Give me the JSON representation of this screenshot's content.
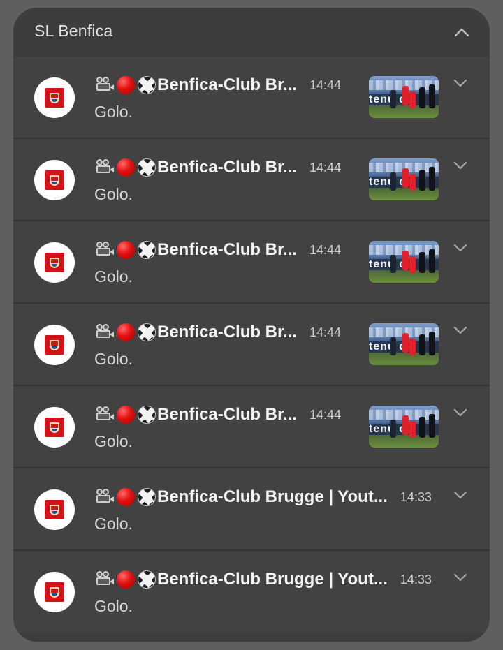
{
  "group": {
    "title": "SL Benfica",
    "collapse_icon": "chevron-up-icon"
  },
  "notifications": [
    {
      "title": "Benfica-Club Br...",
      "time": "14:44",
      "body": "Golo.",
      "has_thumbnail": true
    },
    {
      "title": "Benfica-Club Br...",
      "time": "14:44",
      "body": "Golo.",
      "has_thumbnail": true
    },
    {
      "title": "Benfica-Club Br...",
      "time": "14:44",
      "body": "Golo.",
      "has_thumbnail": true
    },
    {
      "title": "Benfica-Club Br...",
      "time": "14:44",
      "body": "Golo.",
      "has_thumbnail": true
    },
    {
      "title": "Benfica-Club Br...",
      "time": "14:44",
      "body": "Golo.",
      "has_thumbnail": true
    },
    {
      "title": "Benfica-Club Brugge | Yout...",
      "time": "14:33",
      "body": "Golo.",
      "has_thumbnail": false
    },
    {
      "title": "Benfica-Club Brugge | Yout...",
      "time": "14:33",
      "body": "Golo.",
      "has_thumbnail": false
    }
  ],
  "title_emojis": [
    "movie-camera-icon",
    "red-circle-icon",
    "soccer-ball-icon"
  ],
  "thumbnail_board_text": "tenu d",
  "colors": {
    "background": "#5f5f5f",
    "panel": "#3d3d3d",
    "card": "#424242",
    "benfica_red": "#d3121c"
  }
}
